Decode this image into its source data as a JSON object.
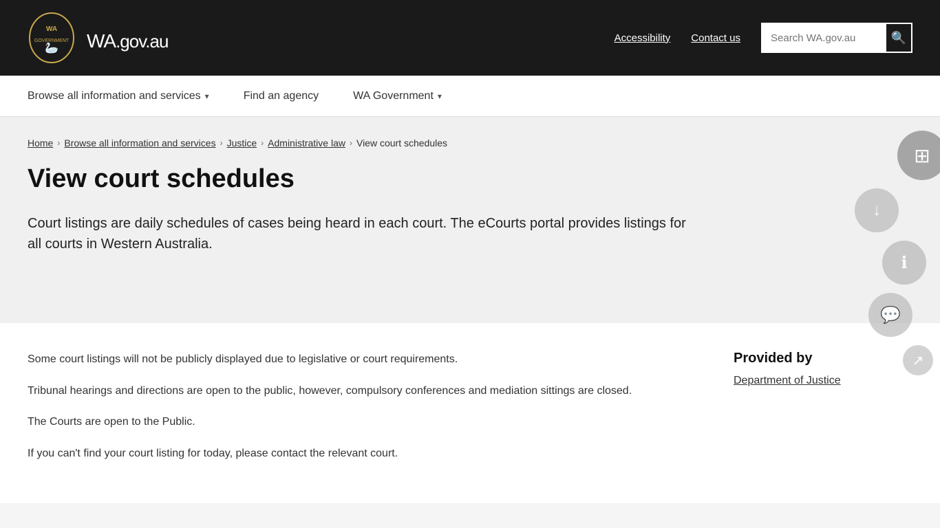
{
  "header": {
    "logo_text": "WA",
    "logo_suffix": ".gov.au",
    "accessibility_label": "Accessibility",
    "contact_label": "Contact us",
    "search_placeholder": "Search WA.gov.au"
  },
  "nav": {
    "items": [
      {
        "id": "browse",
        "label": "Browse all information and services",
        "has_dropdown": true
      },
      {
        "id": "find-agency",
        "label": "Find an agency",
        "has_dropdown": false
      },
      {
        "id": "wa-government",
        "label": "WA Government",
        "has_dropdown": true
      }
    ]
  },
  "breadcrumb": {
    "items": [
      {
        "id": "home",
        "label": "Home",
        "is_link": true
      },
      {
        "id": "browse",
        "label": "Browse all information and services",
        "is_link": true
      },
      {
        "id": "justice",
        "label": "Justice",
        "is_link": true
      },
      {
        "id": "admin-law",
        "label": "Administrative law",
        "is_link": true
      },
      {
        "id": "current",
        "label": "View court schedules",
        "is_link": false
      }
    ]
  },
  "page": {
    "title": "View court schedules",
    "description": "Court listings are daily schedules of cases being heard in each court.  The eCourts portal provides listings for all courts in Western Australia."
  },
  "main_content": {
    "paragraphs": [
      "Some court listings will not be publicly displayed due to legislative or court requirements.",
      "Tribunal hearings and directions are open to the public, however, compulsory conferences and mediation sittings are closed.",
      "The Courts are open to the Public.",
      "If you can't find your court listing for today, please contact the relevant court."
    ]
  },
  "sidebar": {
    "provided_by_label": "Provided by",
    "dept_link": "Department of Justice"
  },
  "fabs": [
    {
      "id": "layers-fab",
      "icon": "⊕",
      "size": "xlarge"
    },
    {
      "id": "download-fab",
      "icon": "↓",
      "size": "large"
    },
    {
      "id": "info-fab",
      "icon": "ℹ",
      "size": "large"
    },
    {
      "id": "chat-fab",
      "icon": "💬",
      "size": "large"
    },
    {
      "id": "share-fab",
      "icon": "↗",
      "size": "large"
    }
  ]
}
